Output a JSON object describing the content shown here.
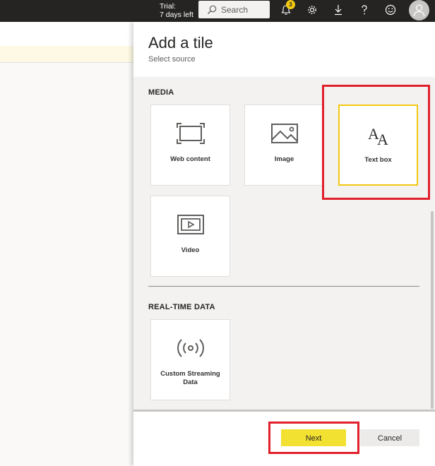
{
  "topbar": {
    "trial_line1": "Trial:",
    "trial_line2": "7 days left",
    "search_placeholder": "Search",
    "notification_count": "3",
    "icons": [
      "bell-icon",
      "gear-icon",
      "download-icon",
      "help-icon",
      "smiley-icon",
      "user-icon"
    ]
  },
  "panel": {
    "title": "Add a tile",
    "subtitle": "Select source",
    "sections": [
      {
        "heading": "MEDIA",
        "tiles": [
          {
            "label": "Web content",
            "icon": "web-content-icon"
          },
          {
            "label": "Image",
            "icon": "image-icon"
          },
          {
            "label": "Text box",
            "icon": "text-box-icon",
            "selected": true
          },
          {
            "label": "Video",
            "icon": "video-icon"
          }
        ]
      },
      {
        "heading": "REAL-TIME DATA",
        "tiles": [
          {
            "label": "Custom Streaming Data",
            "icon": "streaming-icon"
          }
        ]
      }
    ],
    "next_label": "Next",
    "cancel_label": "Cancel"
  },
  "colors": {
    "topbar": "#252423",
    "accent_yellow": "#f2c811",
    "highlight_red": "#e0202c"
  }
}
